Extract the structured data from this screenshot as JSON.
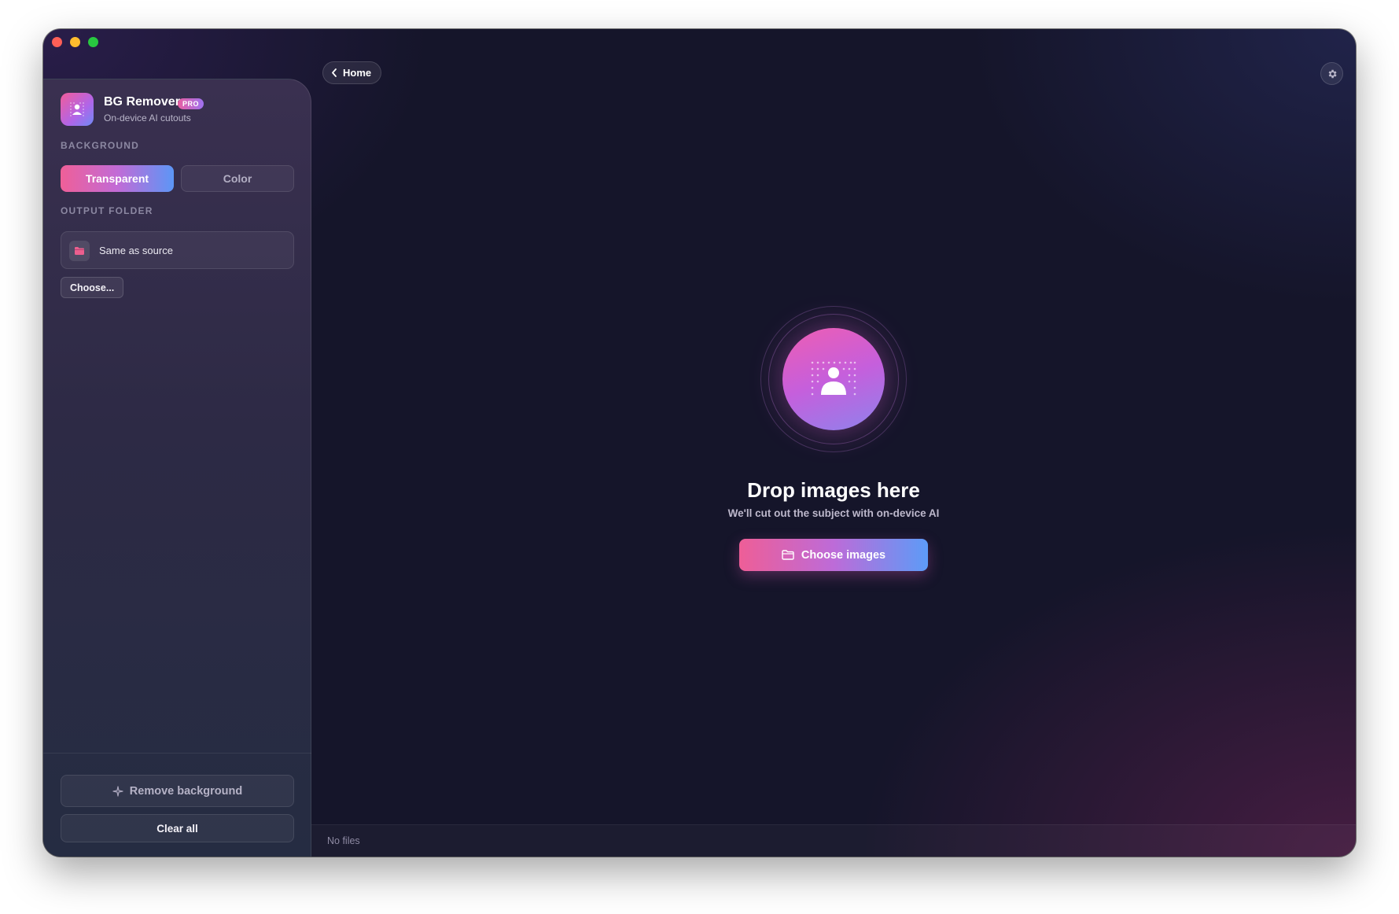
{
  "window": {
    "controls": [
      "close",
      "minimize",
      "zoom"
    ]
  },
  "sidebar": {
    "app_name": "BG Remover",
    "badge": "PRO",
    "app_subtitle": "On-device AI cutouts",
    "background_label": "BACKGROUND",
    "background_options": [
      "Transparent",
      "Color"
    ],
    "background_selected": "Transparent",
    "output_label": "OUTPUT FOLDER",
    "output_value": "Same as source",
    "choose_button": "Choose...",
    "remove_button": "Remove background",
    "clear_button": "Clear all"
  },
  "toolbar": {
    "home_label": "Home",
    "settings_icon": "gear-icon"
  },
  "main": {
    "drop_title": "Drop images here",
    "drop_subtitle": "We'll cut out the subject with on-device AI",
    "choose_images_label": "Choose images"
  },
  "status": {
    "text": "No files"
  },
  "colors": {
    "accent_pink": "#ee5e97",
    "accent_purple": "#bd6bd8",
    "accent_blue": "#5d9bf7",
    "background": "#15152a"
  }
}
